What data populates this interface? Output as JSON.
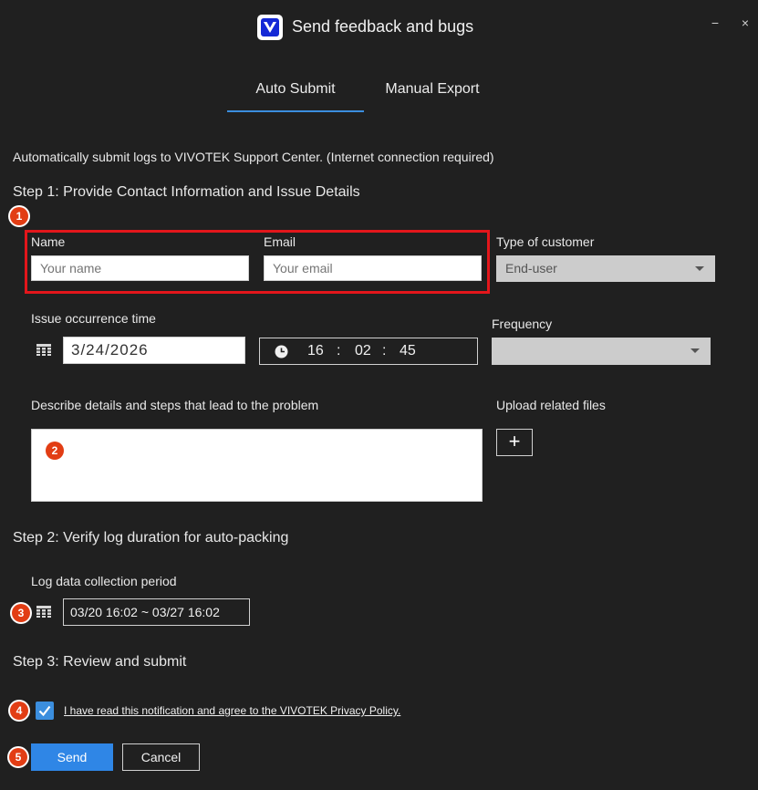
{
  "window": {
    "title": "Send feedback and bugs",
    "minimize_label": "−",
    "close_label": "×"
  },
  "tabs": [
    {
      "label": "Auto Submit",
      "active": true
    },
    {
      "label": "Manual Export",
      "active": false
    }
  ],
  "intro": "Automatically submit logs to VIVOTEK Support Center. (Internet connection required)",
  "step1": {
    "heading": "Step 1: Provide Contact Information and Issue Details",
    "badge": "1",
    "name_label": "Name",
    "name_placeholder": "Your name",
    "email_label": "Email",
    "email_placeholder": "Your email",
    "customer_type_label": "Type of customer",
    "customer_type_value": "End-user",
    "issue_time_label": "Issue occurrence time",
    "issue_date": "3/24/2026",
    "issue_time": {
      "hour": "16",
      "minute": "02",
      "second": "45",
      "separator": ":"
    },
    "frequency_label": "Frequency",
    "frequency_value": "",
    "describe_label": "Describe details and steps that lead to the problem",
    "describe_badge": "2",
    "upload_label": "Upload related files",
    "upload_button": "+"
  },
  "step2": {
    "heading": "Step 2: Verify log duration for auto-packing",
    "period_label": "Log data collection period",
    "badge": "3",
    "period_value": "03/20 16:02 ~ 03/27 16:02"
  },
  "step3": {
    "heading": "Step 3: Review and submit",
    "checkbox_badge": "4",
    "agree_checked": true,
    "policy_text": "I have read this notification and agree to the VIVOTEK Privacy Policy.",
    "buttons_badge": "5",
    "send_label": "Send",
    "cancel_label": "Cancel"
  },
  "colors": {
    "background": "#202020",
    "accent": "#2f86e6",
    "highlight_border": "#e3161b",
    "badge": "#e23d14"
  }
}
